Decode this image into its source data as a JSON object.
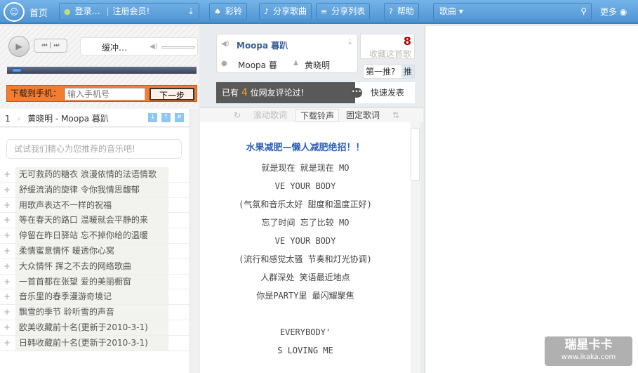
{
  "topbar": {
    "home": "首页",
    "login": "登录…",
    "register": "注册会员!",
    "ringtone": "彩铃",
    "share_song": "分享歌曲",
    "share_list": "分享列表",
    "help": "帮助",
    "search_type": "歌曲",
    "more": "更多"
  },
  "player": {
    "status": "缓冲…",
    "progress": 0.02,
    "download_label": "下载到手机：",
    "phone_placeholder": "输入手机号",
    "next_button": "下一步"
  },
  "now_playing": {
    "index": "1",
    "title": "黄晓明  - Moopa 暮趴"
  },
  "recommend_hint": "试试我们精心为您推荐的音乐吧!",
  "list": [
    "无可救药的糖衣 浪漫侬情的法语情歌",
    "舒缓流淌的旋律 令你我情思馥郁",
    "用歌声表达不一样的祝福",
    "等在春天的路口 温暖就会平静的来",
    "停留在昨日驿站 忘不掉你给的温暖",
    "柔情蜜意情怀 暖透你心窝",
    "大众情怀 挥之不去的网络歌曲",
    "一首首都在张望 爱的美丽橱窗",
    "音乐里的春季漫游奇境记",
    "飘雪的季节 聆听雪的声音",
    "欧美收藏前十名(更新于2010-3-1)",
    "日韩收藏前十名(更新于2010-3-1)"
  ],
  "song": {
    "title": "Moopa 暮趴",
    "album": "Moopa 暮",
    "artist": "黄晓明",
    "fav_count": "8",
    "fav_label": "收藏这首歌",
    "push_label": "第一推?",
    "push_button": "推",
    "comments_pre": "已有",
    "comments_count": "4",
    "comments_post": "位网友评论过!",
    "quick_post": "快速发表"
  },
  "tabs": {
    "scroll": "滚动歌词",
    "ringtone": "下载铃声",
    "fixed": "固定歌词"
  },
  "lyrics": {
    "ad": "水果减肥—懒人减肥绝招！！",
    "lines": [
      "就是现在 就是现在 MO",
      "VE YOUR BODY",
      "(气氛和音乐太好 甜度和温度正好)",
      "忘了时间 忘了比较 MO",
      "VE YOUR BODY",
      "(流行和感觉太骚 节奏和灯光协调)",
      "人群深处 笑语最近地点",
      "你是PARTY里 最闪耀聚焦",
      "",
      "EVERYBODY'",
      "S LOVING ME"
    ]
  },
  "watermark": {
    "name": "瑞星卡卡",
    "url": "www.ikaka.com"
  }
}
